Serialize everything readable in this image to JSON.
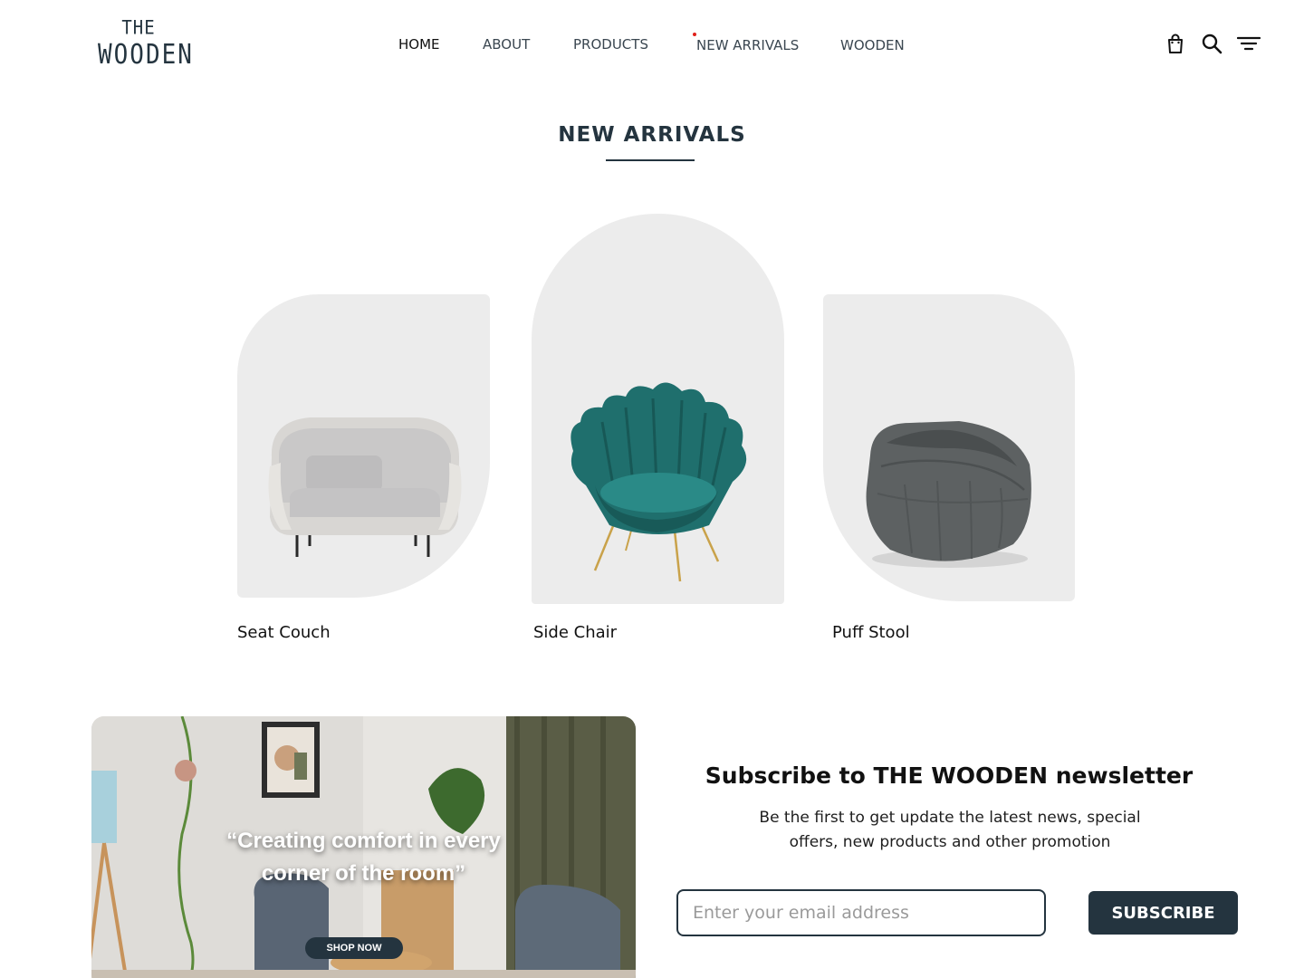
{
  "brand": {
    "logo_top": "THE",
    "logo_bottom": "WOODEN"
  },
  "nav": {
    "items": [
      {
        "label": "HOME",
        "active": true
      },
      {
        "label": "ABOUT"
      },
      {
        "label": "PRODUCTS"
      },
      {
        "label": "NEW ARRIVALS"
      },
      {
        "label": "WOODEN"
      }
    ]
  },
  "header_icons": [
    "shopping-bag-icon",
    "search-icon",
    "filter-menu-icon"
  ],
  "section": {
    "title": "NEW ARRIVALS"
  },
  "products": [
    {
      "name": "Seat Couch"
    },
    {
      "name": "Side Chair"
    },
    {
      "name": "Puff Stool"
    }
  ],
  "banner": {
    "quote": "“Creating comfort in every corner of the room”",
    "button_label": "SHOP NOW"
  },
  "newsletter": {
    "title": "Subscribe to THE WOODEN  newsletter",
    "description": "Be the first to get update the latest news, special offers, new products and other promotion",
    "email_placeholder": "Enter your email address",
    "button_label": "SUBSCRIBE"
  },
  "colors": {
    "primary": "#24343f",
    "card_bg": "#ececec",
    "accent_dot": "#e0201a"
  }
}
